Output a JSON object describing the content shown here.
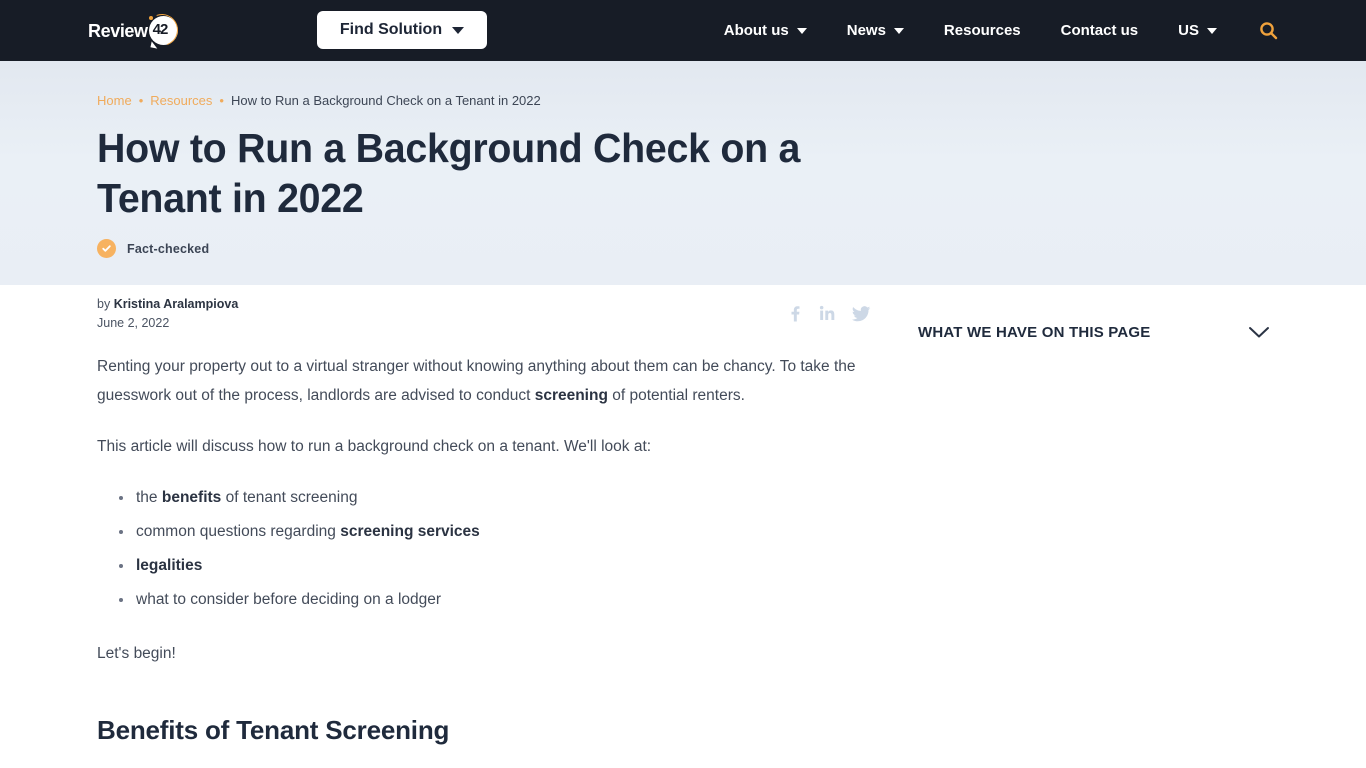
{
  "header": {
    "logo": {
      "text": "Review",
      "badge": "42",
      "name": "review42-logo"
    },
    "cta": {
      "label": "Find Solution",
      "icon": "chevron-down-icon"
    },
    "nav": [
      {
        "label": "About us",
        "has_dropdown": true
      },
      {
        "label": "News",
        "has_dropdown": true
      },
      {
        "label": "Resources",
        "has_dropdown": false
      },
      {
        "label": "Contact us",
        "has_dropdown": false
      },
      {
        "label": "US",
        "has_dropdown": true
      }
    ],
    "search_icon": "search-icon",
    "background": "#171c26",
    "accent": "#f0a23c"
  },
  "hero": {
    "breadcrumb": {
      "items": [
        "Home",
        "Resources"
      ],
      "separator": "•",
      "current": "How to Run a Background Check on a Tenant in 2022"
    },
    "title": "How to Run a Background Check on a Tenant in 2022",
    "fact_checked": {
      "label": "Fact-checked",
      "icon": "check-circle-icon",
      "color": "#f7b260"
    },
    "background": "#e9eef5"
  },
  "article": {
    "byline_prefix": "by",
    "author": "Kristina Aralampiova",
    "date": "June 2, 2022",
    "socials": [
      {
        "name": "facebook-icon",
        "label": "Facebook"
      },
      {
        "name": "linkedin-icon",
        "label": "LinkedIn"
      },
      {
        "name": "twitter-icon",
        "label": "Twitter"
      }
    ],
    "paragraph1_a": "Renting your property out to a virtual stranger without knowing anything about them can be chancy. To take the guesswork out of the process, landlords are advised to conduct ",
    "paragraph1_b": "screening",
    "paragraph1_c": " of potential renters.",
    "paragraph2": "This article will discuss how to run a background check on a tenant. We'll look at:",
    "bullets": [
      {
        "pre": "the ",
        "bold": "benefits",
        "post": " of tenant screening"
      },
      {
        "pre": "common questions regarding ",
        "bold": "screening services",
        "post": ""
      },
      {
        "pre": "",
        "bold": "legalities",
        "post": ""
      },
      {
        "pre": "what to consider before deciding on a lodger",
        "bold": "",
        "post": ""
      }
    ],
    "paragraph3": "Let's begin!",
    "heading2": "Benefits of Tenant Screening"
  },
  "sidebar": {
    "toc_title": "WHAT WE HAVE ON THIS PAGE",
    "toggle_icon": "chevron-down-icon"
  }
}
